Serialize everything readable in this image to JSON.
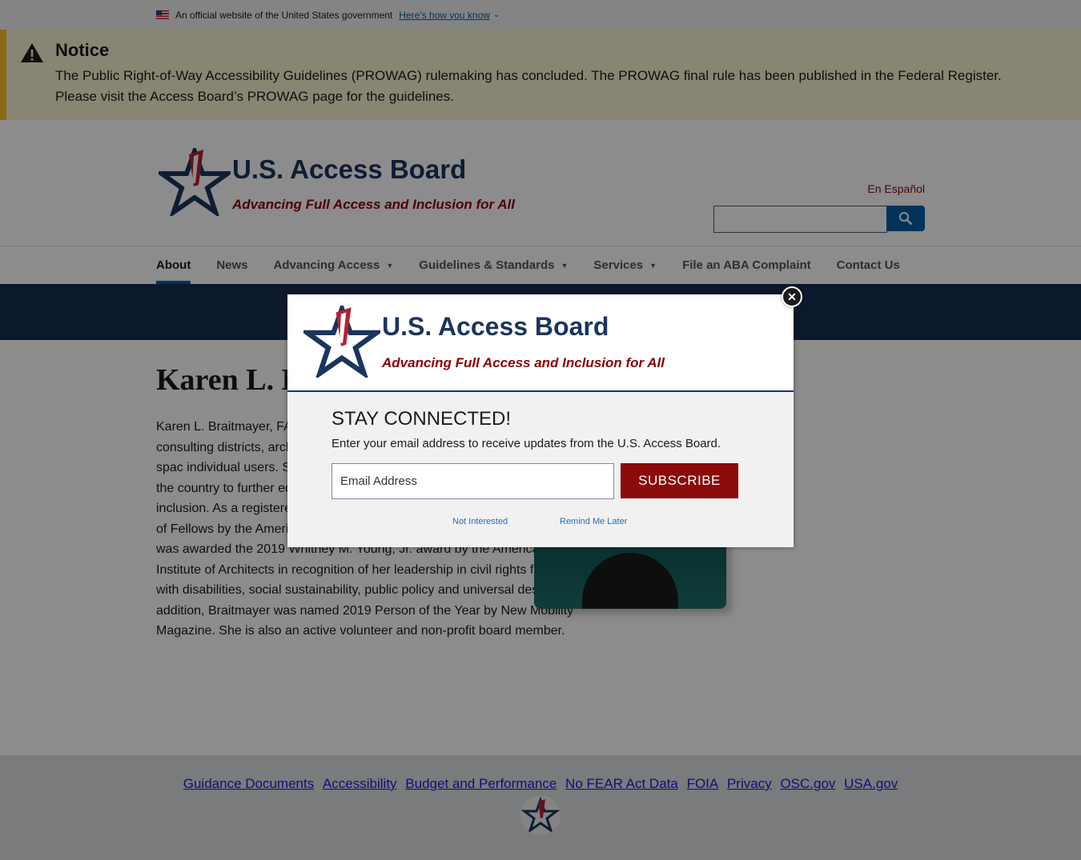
{
  "gov_banner": {
    "text": "An official website of the United States government",
    "link": "Here's how you know"
  },
  "notice": {
    "title": "Notice",
    "text": "The Public Right-of-Way Accessibility Guidelines (PROWAG) rulemaking has concluded. The PROWAG final rule has been published in the Federal Register. Please visit the Access Board’s PROWAG page for the guidelines."
  },
  "header": {
    "title": "U.S. Access Board",
    "tagline": "Advancing Full Access and Inclusion for All",
    "language_link": "En Español",
    "search_placeholder": ""
  },
  "nav": {
    "items": [
      {
        "label": "About"
      },
      {
        "label": "News"
      },
      {
        "label": "Advancing Access"
      },
      {
        "label": "Guidelines & Standards"
      },
      {
        "label": "Services"
      },
      {
        "label": "File an ABA Complaint"
      },
      {
        "label": "Contact Us"
      }
    ]
  },
  "main": {
    "title": "Karen L. B",
    "bio": "Karen L. Braitmayer, FAIA of Studio Pacifica, an access that provides consulting districts, architects, en concerned with comply as well as creating spac individual users. She also leads presentations and workshops around the country to further educate professionals about codes, standards, and inclusion. As a registered architect, Braitmayer was admitted to the College of Fellows by the American Institute of Architects (AIA). Most recently she was awarded the 2019 Whitney M. Young, Jr. award by the American Institute of Architects in recognition of her leadership in civil rights for people with disabilities, social sustainability, public policy and universal design. In addition, Braitmayer was named 2019 Person of the Year by New Mobility Magazine. She is also an active volunteer and non-profit board member."
  },
  "footer": {
    "links": [
      "Guidance Documents",
      "Accessibility",
      "Budget and Performance",
      "No FEAR Act Data",
      "FOIA",
      "Privacy",
      "OSC.gov",
      "USA.gov"
    ]
  },
  "modal": {
    "title": "U.S. Access Board",
    "tagline": "Advancing Full Access and Inclusion for All",
    "heading": "STAY CONNECTED!",
    "text": "Enter your email address to receive updates from the U.S. Access Board.",
    "email_placeholder": "Email Address",
    "subscribe_label": "SUBSCRIBE",
    "not_interested": "Not Interested",
    "remind_later": "Remind Me Later"
  },
  "colors": {
    "brand_navy": "#1a355e",
    "brand_red": "#8b0000",
    "notice_bg": "#faf3d1",
    "notice_border": "#ffbe2e",
    "hero_band": "#162e51"
  },
  "icons": [
    "us-flag-icon",
    "warning-icon",
    "search-icon",
    "star-logo-icon",
    "close-icon",
    "chevron-down-icon"
  ]
}
